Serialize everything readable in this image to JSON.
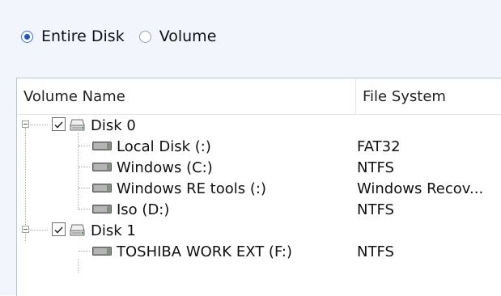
{
  "scope": {
    "options": [
      {
        "label": "Entire Disk",
        "selected": true
      },
      {
        "label": "Volume",
        "selected": false
      }
    ]
  },
  "columns": [
    "Volume Name",
    "File System"
  ],
  "tree": [
    {
      "type": "disk",
      "name": "Disk 0",
      "file_system": "",
      "checked": true,
      "icon": "hard-disk-icon"
    },
    {
      "type": "volume",
      "name": "Local Disk (:)",
      "file_system": "FAT32",
      "icon": "drive-icon"
    },
    {
      "type": "volume",
      "name": "Windows (C:)",
      "file_system": "NTFS",
      "icon": "drive-icon"
    },
    {
      "type": "volume",
      "name": "Windows RE tools (:)",
      "file_system": "Windows Recov...",
      "icon": "drive-icon"
    },
    {
      "type": "volume",
      "name": "Iso (D:)",
      "file_system": "NTFS",
      "icon": "drive-icon"
    },
    {
      "type": "disk",
      "name": "Disk 1",
      "file_system": "",
      "checked": true,
      "icon": "hard-disk-icon"
    },
    {
      "type": "volume",
      "name": "TOSHIBA WORK EXT (F:)",
      "file_system": "NTFS",
      "icon": "drive-icon"
    }
  ],
  "colors": {
    "background": "#f2f5fb",
    "radio_selected": "#1f56b8"
  }
}
